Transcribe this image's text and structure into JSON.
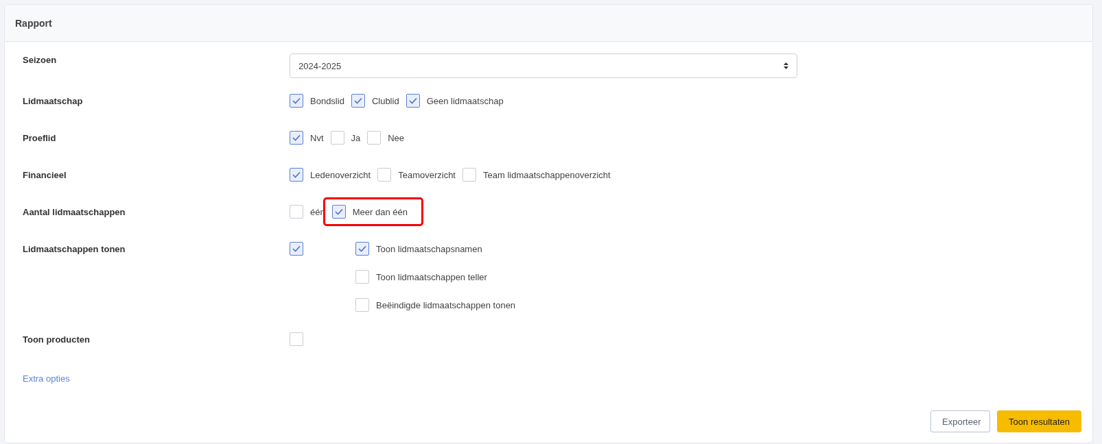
{
  "panel": {
    "title": "Rapport"
  },
  "fields": [
    {
      "kind": "select",
      "label": "Seizoen",
      "value": "2024-2025"
    },
    {
      "kind": "checkboxes",
      "label": "Lidmaatschap",
      "options": [
        {
          "label": "Bondslid",
          "checked": true
        },
        {
          "label": "Clublid",
          "checked": true
        },
        {
          "label": "Geen lidmaatschap",
          "checked": true
        }
      ]
    },
    {
      "kind": "checkboxes",
      "label": "Proeflid",
      "options": [
        {
          "label": "Nvt",
          "checked": true
        },
        {
          "label": "Ja",
          "checked": false
        },
        {
          "label": "Nee",
          "checked": false
        }
      ]
    },
    {
      "kind": "checkboxes",
      "label": "Financieel",
      "options": [
        {
          "label": "Ledenoverzicht",
          "checked": true
        },
        {
          "label": "Teamoverzicht",
          "checked": false
        },
        {
          "label": "Team lidmaatschappenoverzicht",
          "checked": false
        }
      ]
    },
    {
      "kind": "checkboxes",
      "label": "Aantal lidmaatschappen",
      "options": [
        {
          "label": "één",
          "checked": false,
          "highlighted": false
        },
        {
          "label": "Meer dan één",
          "checked": true,
          "highlighted": true
        }
      ]
    },
    {
      "kind": "group",
      "label": "Lidmaatschappen tonen",
      "checked": true,
      "options": [
        {
          "label": "Toon lidmaatschapsnamen",
          "checked": true
        },
        {
          "label": "Toon lidmaatschappen teller",
          "checked": false
        },
        {
          "label": "Beëindigde lidmaatschappen tonen",
          "checked": false
        }
      ]
    },
    {
      "kind": "single",
      "label": "Toon producten",
      "checked": false
    }
  ],
  "extra_link": "Extra opties",
  "buttons": [
    {
      "label": "Exporteer",
      "kind": "secondary"
    },
    {
      "label": "Toon resultaten",
      "kind": "primary"
    }
  ]
}
